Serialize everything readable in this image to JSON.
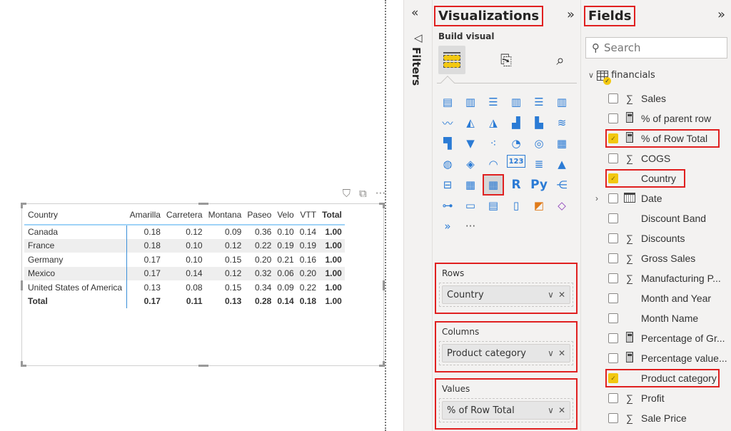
{
  "visual_header": {
    "filter_icon": "filter-icon",
    "focus_icon": "focus-mode-icon",
    "more_icon": "more-options-icon"
  },
  "matrix": {
    "headers": [
      "Country",
      "Amarilla",
      "Carretera",
      "Montana",
      "Paseo",
      "Velo",
      "VTT",
      "Total"
    ],
    "rows": [
      [
        "Canada",
        "0.18",
        "0.12",
        "0.09",
        "0.36",
        "0.10",
        "0.14",
        "1.00"
      ],
      [
        "France",
        "0.18",
        "0.10",
        "0.12",
        "0.22",
        "0.19",
        "0.19",
        "1.00"
      ],
      [
        "Germany",
        "0.17",
        "0.10",
        "0.15",
        "0.20",
        "0.21",
        "0.16",
        "1.00"
      ],
      [
        "Mexico",
        "0.17",
        "0.14",
        "0.12",
        "0.32",
        "0.06",
        "0.20",
        "1.00"
      ],
      [
        "United States of America",
        "0.13",
        "0.08",
        "0.15",
        "0.34",
        "0.09",
        "0.22",
        "1.00"
      ]
    ],
    "total_row": [
      "Total",
      "0.17",
      "0.11",
      "0.13",
      "0.28",
      "0.14",
      "0.18",
      "1.00"
    ]
  },
  "filters": {
    "collapse_glyph": "«",
    "label": "Filters"
  },
  "visualizations": {
    "title": "Visualizations",
    "expand_glyph": "»",
    "build_label": "Build visual",
    "tabs": [
      "build-visual",
      "format-visual",
      "analytics"
    ],
    "icons": [
      {
        "name": "stacked-bar-chart",
        "glyph": "▤"
      },
      {
        "name": "stacked-column-chart",
        "glyph": "▥"
      },
      {
        "name": "clustered-bar-chart",
        "glyph": "☰"
      },
      {
        "name": "clustered-column-chart",
        "glyph": "▥"
      },
      {
        "name": "100-stacked-bar-chart",
        "glyph": "☰"
      },
      {
        "name": "100-stacked-column-chart",
        "glyph": "▥"
      },
      {
        "name": "line-chart",
        "glyph": "〰"
      },
      {
        "name": "area-chart",
        "glyph": "◭"
      },
      {
        "name": "stacked-area-chart",
        "glyph": "◮"
      },
      {
        "name": "line-and-stacked-column-chart",
        "glyph": "▟"
      },
      {
        "name": "line-and-clustered-column-chart",
        "glyph": "▙"
      },
      {
        "name": "ribbon-chart",
        "glyph": "≋"
      },
      {
        "name": "waterfall-chart",
        "glyph": "▜"
      },
      {
        "name": "funnel-chart",
        "glyph": "▼"
      },
      {
        "name": "scatter-chart",
        "glyph": "⁖"
      },
      {
        "name": "pie-chart",
        "glyph": "◔"
      },
      {
        "name": "donut-chart",
        "glyph": "◎"
      },
      {
        "name": "treemap",
        "glyph": "▦"
      },
      {
        "name": "map",
        "glyph": "◍"
      },
      {
        "name": "filled-map",
        "glyph": "◈"
      },
      {
        "name": "gauge",
        "glyph": "◠"
      },
      {
        "name": "card",
        "glyph": "123"
      },
      {
        "name": "multi-row-card",
        "glyph": "≣"
      },
      {
        "name": "kpi",
        "glyph": "▲"
      },
      {
        "name": "slicer",
        "glyph": "⊟"
      },
      {
        "name": "table",
        "glyph": "▦"
      },
      {
        "name": "matrix",
        "glyph": "▦"
      },
      {
        "name": "r-script-visual",
        "glyph": "R"
      },
      {
        "name": "python-visual",
        "glyph": "Py"
      },
      {
        "name": "key-influencers",
        "glyph": "⋲"
      },
      {
        "name": "decomposition-tree",
        "glyph": "⊶"
      },
      {
        "name": "q-and-a",
        "glyph": "▭"
      },
      {
        "name": "smart-narrative",
        "glyph": "▤"
      },
      {
        "name": "paginated-report",
        "glyph": "▯"
      },
      {
        "name": "azure-map",
        "glyph": "◩"
      },
      {
        "name": "power-apps",
        "glyph": "◇"
      },
      {
        "name": "power-automate",
        "glyph": "»"
      },
      {
        "name": "more-visuals",
        "glyph": "···"
      }
    ],
    "selected_icon": "matrix",
    "wells": [
      {
        "title": "Rows",
        "field": "Country"
      },
      {
        "title": "Columns",
        "field": "Product category"
      },
      {
        "title": "Values",
        "field": "% of Row Total"
      }
    ],
    "pill_chevron": "∨",
    "pill_remove": "✕"
  },
  "fields": {
    "title": "Fields",
    "expand_glyph": "»",
    "search_placeholder": "Search",
    "table_name": "financials",
    "items": [
      {
        "label": "Sales",
        "icon": "sigma",
        "checked": false
      },
      {
        "label": "% of parent row",
        "icon": "calculator",
        "checked": false
      },
      {
        "label": "% of Row Total",
        "icon": "calculator",
        "checked": true,
        "highlight": true
      },
      {
        "label": "COGS",
        "icon": "sigma",
        "checked": false
      },
      {
        "label": "Country",
        "icon": "none",
        "checked": true,
        "highlight": true
      },
      {
        "label": "Date",
        "icon": "calendar",
        "checked": false,
        "expandable": true
      },
      {
        "label": "Discount Band",
        "icon": "none",
        "checked": false
      },
      {
        "label": "Discounts",
        "icon": "sigma",
        "checked": false
      },
      {
        "label": "Gross Sales",
        "icon": "sigma",
        "checked": false
      },
      {
        "label": "Manufacturing P...",
        "icon": "sigma",
        "checked": false
      },
      {
        "label": "Month and Year",
        "icon": "none",
        "checked": false
      },
      {
        "label": "Month Name",
        "icon": "none",
        "checked": false
      },
      {
        "label": "Percentage of Gr...",
        "icon": "calculator",
        "checked": false
      },
      {
        "label": "Percentage value...",
        "icon": "calculator",
        "checked": false
      },
      {
        "label": "Product category",
        "icon": "none",
        "checked": true,
        "highlight": true
      },
      {
        "label": "Profit",
        "icon": "sigma",
        "checked": false
      },
      {
        "label": "Sale Price",
        "icon": "sigma",
        "checked": false
      }
    ]
  },
  "colors": {
    "accent_red": "#e02020",
    "check_yellow": "#f2c811",
    "matrix_blue": "#3a8fd8",
    "header_line": "#9fd3f7"
  }
}
